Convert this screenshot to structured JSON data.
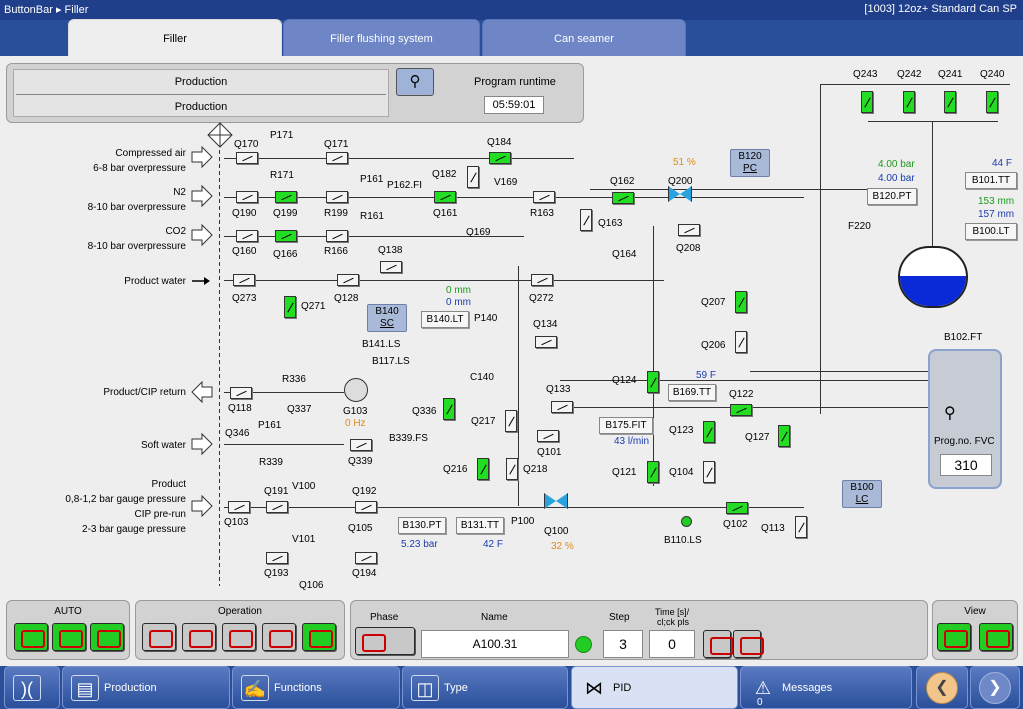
{
  "titlebar": {
    "path": "ButtonBar ▸ Filler",
    "right": "[1003]   12oz+ Standard Can SP"
  },
  "tabs": [
    "Filler",
    "Filler flushing system",
    "Can seamer"
  ],
  "header": {
    "production_top": "Production",
    "production_bottom": "Production",
    "runtime_label": "Program runtime",
    "runtime_value": "05:59:01"
  },
  "inlets": [
    {
      "line1": "Compressed air",
      "line2": "6-8 bar overpressure"
    },
    {
      "line1": "N2",
      "line2": "8-10 bar overpressure"
    },
    {
      "line1": "CO2",
      "line2": "8-10 bar overpressure"
    },
    {
      "line1": "Product water",
      "line2": ""
    },
    {
      "line1": "Product/CIP return",
      "line2": ""
    },
    {
      "line1": "Soft water",
      "line2": ""
    }
  ],
  "product_inlet": [
    "Product",
    "0,8-1,2 bar gauge pressure",
    "CIP pre-run",
    "2-3 bar gauge pressure"
  ],
  "tags": {
    "Q170": "Q170",
    "P171": "P171",
    "R171": "R171",
    "Q171": "Q171",
    "Q184": "Q184",
    "Q190": "Q190",
    "Q199": "Q199",
    "R199": "R199",
    "P161a": "P161",
    "R161": "R161",
    "P162": "P162.FI",
    "Q182": "Q182",
    "Q161": "Q161",
    "V169": "V169",
    "Q169": "Q169",
    "R163": "R163",
    "Q160": "Q160",
    "Q166": "Q166",
    "R166": "R166",
    "Q138": "Q138",
    "Q273": "Q273",
    "Q128": "Q128",
    "Q272": "Q272",
    "Q271": "Q271",
    "Q162": "Q162",
    "Q163": "Q163",
    "Q200": "Q200",
    "Q208": "Q208",
    "Q164": "Q164",
    "Q207": "Q207",
    "Q206": "Q206",
    "P140": "P140",
    "Q134": "Q134",
    "B141": "B141.LS",
    "B117": "B117.LS",
    "C140": "C140",
    "R336": "R336",
    "Q118": "Q118",
    "Q337": "Q337",
    "G103": "G103",
    "Q336": "Q336",
    "Q133": "Q133",
    "B339": "B339.FS",
    "Q346": "Q346",
    "P161b": "P161",
    "R339": "R339",
    "Q339": "Q339",
    "Q217": "Q217",
    "Q216": "Q216",
    "Q218": "Q218",
    "Q101": "Q101",
    "Q124": "Q124",
    "Q122": "Q122",
    "Q123": "Q123",
    "Q121": "Q121",
    "Q104": "Q104",
    "Q127": "Q127",
    "V100": "V100",
    "Q191": "Q191",
    "Q192": "Q192",
    "Q103": "Q103",
    "Q105": "Q105",
    "V101": "V101",
    "Q193": "Q193",
    "Q194": "Q194",
    "Q106": "Q106",
    "P100": "P100",
    "Q100": "Q100",
    "Q102": "Q102",
    "Q113": "Q113",
    "B110": "B110.LS",
    "F220": "F220",
    "B102": "B102.FT",
    "Q243": "Q243",
    "Q242": "Q242",
    "Q241": "Q241",
    "Q240": "Q240"
  },
  "boxes": {
    "B120PC": [
      "B120",
      "PC"
    ],
    "B140SC": [
      "B140",
      "SC"
    ],
    "B100LC": [
      "B100",
      "LC"
    ],
    "B140LT": "B140.LT",
    "B120PT": "B120.PT",
    "B101TT": "B101.TT",
    "B100LT": "B100.LT",
    "B169TT": "B169.TT",
    "B175FIT": "B175.FIT",
    "B130PT": "B130.PT",
    "B131TT": "B131.TT"
  },
  "values": {
    "q200_pct": "51 %",
    "b120_top": "4.00 bar",
    "b120_bot": "4.00 bar",
    "b101": "44 F",
    "b100_mm1": "153 mm",
    "b100_mm2": "157 mm",
    "b140_top": "0 mm",
    "b140_bot": "0 mm",
    "g103_hz": "0 Hz",
    "b169": "59 F",
    "b175": "43 l/min",
    "b130": "5.23 bar",
    "b131": "42 F",
    "q100_pct": "32 %"
  },
  "fvc": {
    "label": "Prog.no. FVC",
    "value": "310"
  },
  "bottom": {
    "auto": "AUTO",
    "operation": "Operation",
    "phase": "Phase",
    "name": "Name",
    "name_value": "A100.31",
    "step": "Step",
    "step_value": "3",
    "time_label1": "Time [s]/",
    "time_label2": "cl;ck pls",
    "time_value": "0",
    "view": "View"
  },
  "nav": [
    "Production",
    "Functions",
    "Type",
    "PID",
    "Messages"
  ],
  "messages_count": "0",
  "colors": {
    "active_green": "#22dd22",
    "header_blue": "#1f3f8a",
    "tank_blue": "#0a2ad8"
  }
}
